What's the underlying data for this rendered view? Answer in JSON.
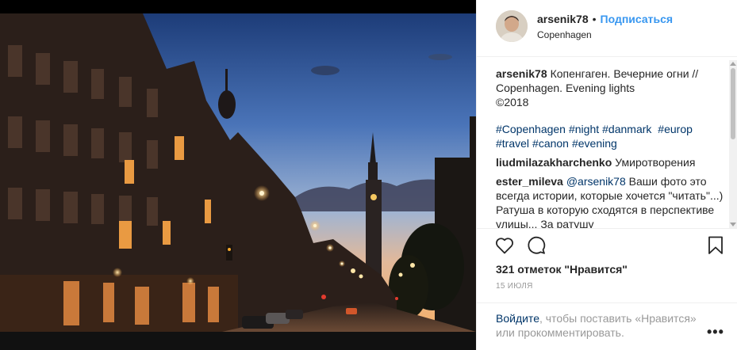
{
  "post": {
    "username": "arsenik78",
    "dot": "•",
    "follow_label": "Подписаться",
    "location": "Copenhagen"
  },
  "caption": {
    "username": "arsenik78",
    "text": "Копенгаген. Вечерние огни //\nCopenhagen. Evening lights\n©2018",
    "hashtags": [
      "#Copenhagen",
      "#night",
      "#danmark",
      "#europ",
      "#travel",
      "#canon",
      "#evening"
    ]
  },
  "comments": [
    {
      "user": "liudmilazakharchenko",
      "mention": "",
      "text": "Умиротворения"
    },
    {
      "user": "ester_mileva",
      "mention": "@arsenik78",
      "text": "Ваши фото это всегда истории, которые хочется \"читать\"...) Ратуша в которую сходятся в перспективе улицы... За ратушу"
    }
  ],
  "likes": {
    "count_text": "321 отметок \"Нравится\""
  },
  "date": "15 июля",
  "footer": {
    "login_link": "Войдите",
    "login_rest": ", чтобы поставить «Нравится» или прокомментировать.",
    "more": "•••"
  },
  "icons": {
    "like": "heart-outline-icon",
    "comment": "speech-bubble-icon",
    "save": "bookmark-icon",
    "more": "ellipsis-icon"
  },
  "colors": {
    "link_blue": "#3897f0",
    "hashtag_blue": "#003569",
    "text": "#262626",
    "muted": "#999999",
    "border": "#efefef"
  }
}
